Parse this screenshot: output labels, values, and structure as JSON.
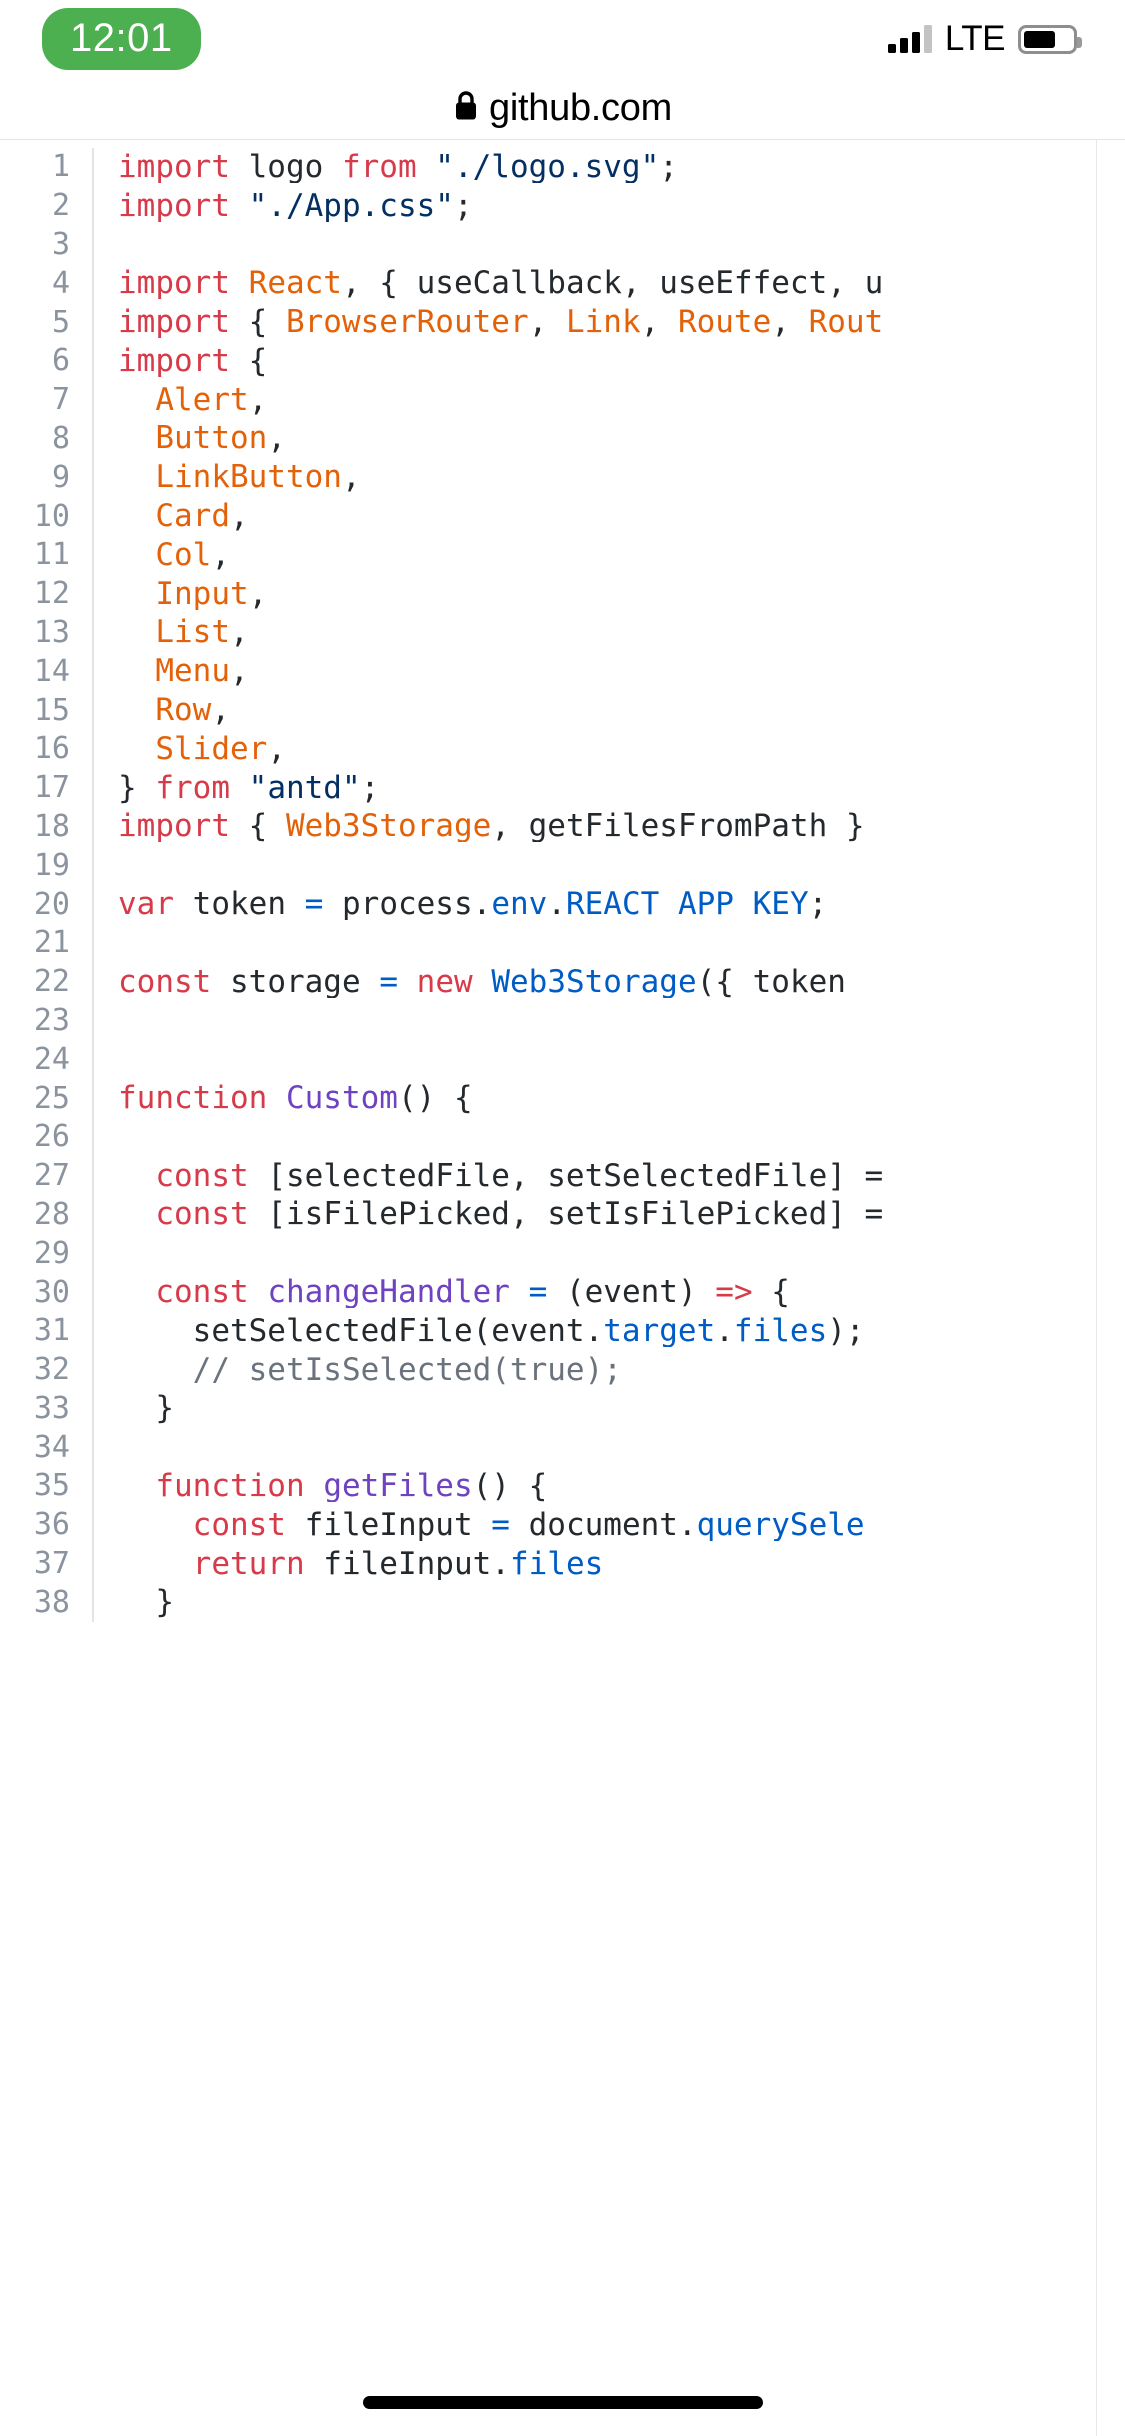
{
  "status_bar": {
    "time": "12:01",
    "time_pill_color": "#4CAF50",
    "carrier_tech": "LTE",
    "signal_icon": "signal-bars-icon",
    "signal_bars_filled": 3,
    "signal_bars_total": 4,
    "battery_icon": "battery-icon",
    "battery_level_percent": 55
  },
  "browser": {
    "lock_icon": "lock-icon",
    "url": "github.com"
  },
  "code": {
    "language": "javascript",
    "colors": {
      "keyword": "#d73a49",
      "string": "#032f62",
      "entity": "#e36209",
      "constant": "#005cc5",
      "function": "#6f42c1",
      "comment": "#6a737d",
      "plain": "#24292e",
      "line_number": "#8b949e"
    },
    "lines": [
      {
        "n": "1",
        "tokens": [
          {
            "t": "import",
            "c": "k"
          },
          {
            "t": " logo ",
            "c": "p"
          },
          {
            "t": "from",
            "c": "k"
          },
          {
            "t": " ",
            "c": "p"
          },
          {
            "t": "\"./logo.svg\"",
            "c": "s"
          },
          {
            "t": ";",
            "c": "p"
          }
        ]
      },
      {
        "n": "2",
        "tokens": [
          {
            "t": "import",
            "c": "k"
          },
          {
            "t": " ",
            "c": "p"
          },
          {
            "t": "\"./App.css\"",
            "c": "s"
          },
          {
            "t": ";",
            "c": "p"
          }
        ]
      },
      {
        "n": "3",
        "tokens": []
      },
      {
        "n": "4",
        "tokens": [
          {
            "t": "import",
            "c": "k"
          },
          {
            "t": " ",
            "c": "p"
          },
          {
            "t": "React",
            "c": "e"
          },
          {
            "t": ", { useCallback, useEffect, u",
            "c": "p"
          }
        ]
      },
      {
        "n": "5",
        "tokens": [
          {
            "t": "import",
            "c": "k"
          },
          {
            "t": " { ",
            "c": "p"
          },
          {
            "t": "BrowserRouter",
            "c": "e"
          },
          {
            "t": ", ",
            "c": "p"
          },
          {
            "t": "Link",
            "c": "e"
          },
          {
            "t": ", ",
            "c": "p"
          },
          {
            "t": "Route",
            "c": "e"
          },
          {
            "t": ", ",
            "c": "p"
          },
          {
            "t": "Rout",
            "c": "e"
          }
        ]
      },
      {
        "n": "6",
        "tokens": [
          {
            "t": "import",
            "c": "k"
          },
          {
            "t": " {",
            "c": "p"
          }
        ]
      },
      {
        "n": "7",
        "tokens": [
          {
            "t": "  ",
            "c": "p"
          },
          {
            "t": "Alert",
            "c": "e"
          },
          {
            "t": ",",
            "c": "p"
          }
        ]
      },
      {
        "n": "8",
        "tokens": [
          {
            "t": "  ",
            "c": "p"
          },
          {
            "t": "Button",
            "c": "e"
          },
          {
            "t": ",",
            "c": "p"
          }
        ]
      },
      {
        "n": "9",
        "tokens": [
          {
            "t": "  ",
            "c": "p"
          },
          {
            "t": "LinkButton",
            "c": "e"
          },
          {
            "t": ",",
            "c": "p"
          }
        ]
      },
      {
        "n": "10",
        "tokens": [
          {
            "t": "  ",
            "c": "p"
          },
          {
            "t": "Card",
            "c": "e"
          },
          {
            "t": ",",
            "c": "p"
          }
        ]
      },
      {
        "n": "11",
        "tokens": [
          {
            "t": "  ",
            "c": "p"
          },
          {
            "t": "Col",
            "c": "e"
          },
          {
            "t": ",",
            "c": "p"
          }
        ]
      },
      {
        "n": "12",
        "tokens": [
          {
            "t": "  ",
            "c": "p"
          },
          {
            "t": "Input",
            "c": "e"
          },
          {
            "t": ",",
            "c": "p"
          }
        ]
      },
      {
        "n": "13",
        "tokens": [
          {
            "t": "  ",
            "c": "p"
          },
          {
            "t": "List",
            "c": "e"
          },
          {
            "t": ",",
            "c": "p"
          }
        ]
      },
      {
        "n": "14",
        "tokens": [
          {
            "t": "  ",
            "c": "p"
          },
          {
            "t": "Menu",
            "c": "e"
          },
          {
            "t": ",",
            "c": "p"
          }
        ]
      },
      {
        "n": "15",
        "tokens": [
          {
            "t": "  ",
            "c": "p"
          },
          {
            "t": "Row",
            "c": "e"
          },
          {
            "t": ",",
            "c": "p"
          }
        ]
      },
      {
        "n": "16",
        "tokens": [
          {
            "t": "  ",
            "c": "p"
          },
          {
            "t": "Slider",
            "c": "e"
          },
          {
            "t": ",",
            "c": "p"
          }
        ]
      },
      {
        "n": "17",
        "tokens": [
          {
            "t": "} ",
            "c": "p"
          },
          {
            "t": "from",
            "c": "k"
          },
          {
            "t": " ",
            "c": "p"
          },
          {
            "t": "\"antd\"",
            "c": "s"
          },
          {
            "t": ";",
            "c": "p"
          }
        ]
      },
      {
        "n": "18",
        "tokens": [
          {
            "t": "import",
            "c": "k"
          },
          {
            "t": " { ",
            "c": "p"
          },
          {
            "t": "Web3Storage",
            "c": "e"
          },
          {
            "t": ", getFilesFromPath }",
            "c": "p"
          }
        ]
      },
      {
        "n": "19",
        "tokens": []
      },
      {
        "n": "20",
        "tokens": [
          {
            "t": "var",
            "c": "k"
          },
          {
            "t": " token ",
            "c": "p"
          },
          {
            "t": "=",
            "c": "b"
          },
          {
            "t": " process.",
            "c": "p"
          },
          {
            "t": "env",
            "c": "b"
          },
          {
            "t": ".",
            "c": "p"
          },
          {
            "t": "REACT_APP_KEY",
            "c": "b"
          },
          {
            "t": ";",
            "c": "p"
          }
        ]
      },
      {
        "n": "21",
        "tokens": []
      },
      {
        "n": "22",
        "tokens": [
          {
            "t": "const",
            "c": "k"
          },
          {
            "t": " storage ",
            "c": "p"
          },
          {
            "t": "=",
            "c": "b"
          },
          {
            "t": " ",
            "c": "p"
          },
          {
            "t": "new",
            "c": "k"
          },
          {
            "t": " ",
            "c": "p"
          },
          {
            "t": "Web3Storage",
            "c": "b"
          },
          {
            "t": "({ token ",
            "c": "p"
          }
        ]
      },
      {
        "n": "23",
        "tokens": []
      },
      {
        "n": "24",
        "tokens": []
      },
      {
        "n": "25",
        "tokens": [
          {
            "t": "function",
            "c": "k"
          },
          {
            "t": " ",
            "c": "p"
          },
          {
            "t": "Custom",
            "c": "f"
          },
          {
            "t": "() {",
            "c": "p"
          }
        ]
      },
      {
        "n": "26",
        "tokens": []
      },
      {
        "n": "27",
        "tokens": [
          {
            "t": "  ",
            "c": "p"
          },
          {
            "t": "const",
            "c": "k"
          },
          {
            "t": " [selectedFile, setSelectedFile] =",
            "c": "p"
          }
        ]
      },
      {
        "n": "28",
        "tokens": [
          {
            "t": "  ",
            "c": "p"
          },
          {
            "t": "const",
            "c": "k"
          },
          {
            "t": " [isFilePicked, setIsFilePicked] =",
            "c": "p"
          }
        ]
      },
      {
        "n": "29",
        "tokens": []
      },
      {
        "n": "30",
        "tokens": [
          {
            "t": "  ",
            "c": "p"
          },
          {
            "t": "const",
            "c": "k"
          },
          {
            "t": " ",
            "c": "p"
          },
          {
            "t": "changeHandler",
            "c": "f"
          },
          {
            "t": " ",
            "c": "p"
          },
          {
            "t": "=",
            "c": "b"
          },
          {
            "t": " (event) ",
            "c": "p"
          },
          {
            "t": "=>",
            "c": "k"
          },
          {
            "t": " {",
            "c": "p"
          }
        ]
      },
      {
        "n": "31",
        "tokens": [
          {
            "t": "    setSelectedFile(event.",
            "c": "p"
          },
          {
            "t": "target",
            "c": "b"
          },
          {
            "t": ".",
            "c": "p"
          },
          {
            "t": "files",
            "c": "b"
          },
          {
            "t": ");",
            "c": "p"
          }
        ]
      },
      {
        "n": "32",
        "tokens": [
          {
            "t": "    // setIsSelected(true);",
            "c": "c"
          }
        ]
      },
      {
        "n": "33",
        "tokens": [
          {
            "t": "  }",
            "c": "p"
          }
        ]
      },
      {
        "n": "34",
        "tokens": []
      },
      {
        "n": "35",
        "tokens": [
          {
            "t": "  ",
            "c": "p"
          },
          {
            "t": "function",
            "c": "k"
          },
          {
            "t": " ",
            "c": "p"
          },
          {
            "t": "getFiles",
            "c": "f"
          },
          {
            "t": "() {",
            "c": "p"
          }
        ]
      },
      {
        "n": "36",
        "tokens": [
          {
            "t": "    ",
            "c": "p"
          },
          {
            "t": "const",
            "c": "k"
          },
          {
            "t": " fileInput ",
            "c": "p"
          },
          {
            "t": "=",
            "c": "b"
          },
          {
            "t": " document.",
            "c": "p"
          },
          {
            "t": "querySele",
            "c": "b"
          }
        ]
      },
      {
        "n": "37",
        "tokens": [
          {
            "t": "    ",
            "c": "p"
          },
          {
            "t": "return",
            "c": "k"
          },
          {
            "t": " fileInput.",
            "c": "p"
          },
          {
            "t": "files",
            "c": "b"
          }
        ]
      },
      {
        "n": "38",
        "tokens": [
          {
            "t": "  }",
            "c": "p"
          }
        ]
      }
    ]
  },
  "home_indicator": {
    "icon": "home-indicator-bar"
  }
}
